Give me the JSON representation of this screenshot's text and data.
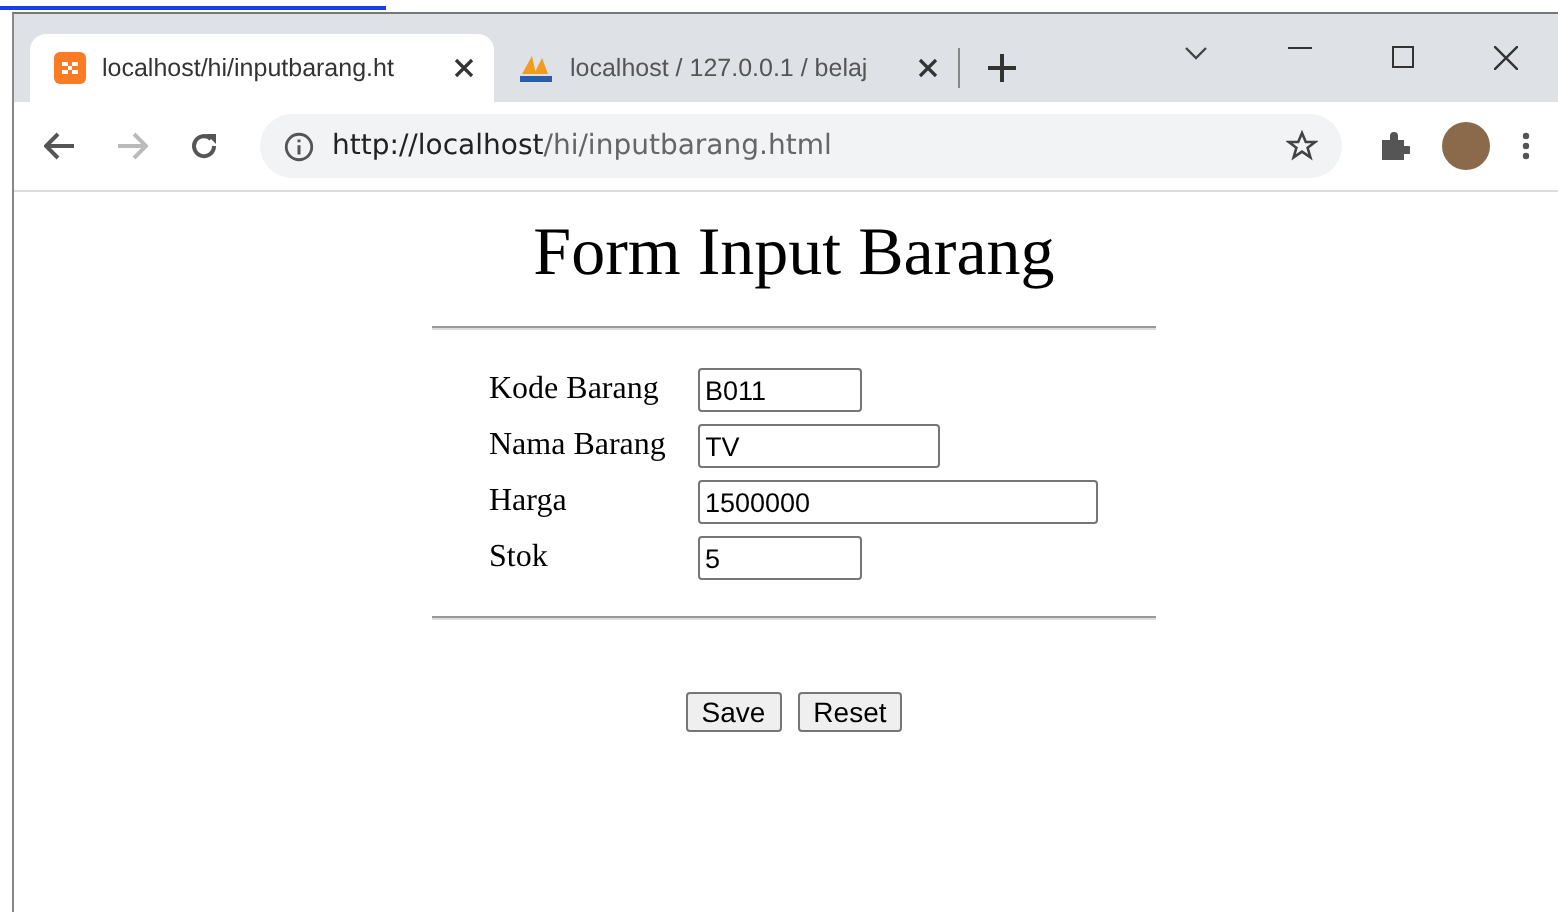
{
  "tabs": [
    {
      "title": "localhost/hi/inputbarang.ht",
      "kind": "xampp",
      "selected": true
    },
    {
      "title": "localhost / 127.0.0.1 / belaj",
      "kind": "pma",
      "selected": false
    }
  ],
  "address_bar": {
    "url_host": "http://localhost",
    "url_path": "/hi/inputbarang.html"
  },
  "page": {
    "title": "Form Input Barang",
    "fields": [
      {
        "label": "Kode Barang",
        "value": "B011"
      },
      {
        "label": "Nama Barang",
        "value": "TV"
      },
      {
        "label": "Harga",
        "value": "1500000"
      },
      {
        "label": "Stok",
        "value": "5"
      }
    ],
    "buttons": [
      "Save",
      "Reset"
    ]
  }
}
